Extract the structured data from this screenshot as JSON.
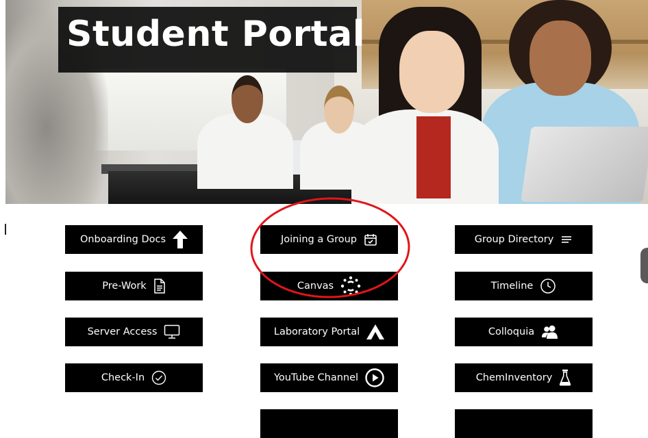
{
  "header": {
    "title": "Student Portal"
  },
  "buttons": {
    "onboarding": {
      "label": "Onboarding Docs",
      "icon": "arrow-up-icon"
    },
    "joining": {
      "label": "Joining a Group",
      "icon": "calendar-check-icon"
    },
    "directory": {
      "label": "Group Directory",
      "icon": "list-lines-icon"
    },
    "prework": {
      "label": "Pre-Work",
      "icon": "document-icon"
    },
    "canvas": {
      "label": "Canvas",
      "icon": "canvas-logo-icon"
    },
    "timeline": {
      "label": "Timeline",
      "icon": "clock-icon"
    },
    "server": {
      "label": "Server Access",
      "icon": "monitor-icon"
    },
    "lab_portal": {
      "label": "Laboratory Portal",
      "icon": "caret-up-logo-icon"
    },
    "colloquia": {
      "label": "Colloquia",
      "icon": "users-icon"
    },
    "checkin": {
      "label": "Check-In",
      "icon": "check-circle-icon"
    },
    "youtube": {
      "label": "YouTube Channel",
      "icon": "play-circle-icon"
    },
    "cheminventory": {
      "label": "ChemInventory",
      "icon": "flask-icon"
    }
  },
  "colors": {
    "button_bg": "#000000",
    "button_text": "#ffffff",
    "annotation": "#e0161b"
  }
}
